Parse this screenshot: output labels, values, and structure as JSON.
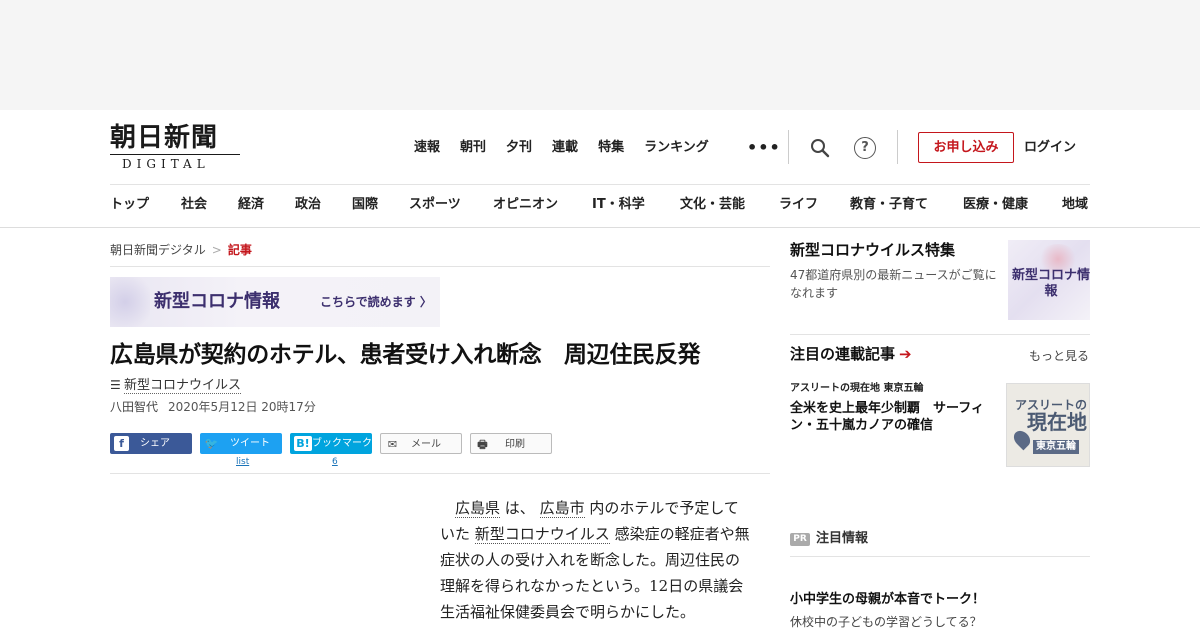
{
  "header": {
    "logo_main": "朝日新聞",
    "logo_sub": "DIGITAL",
    "topnav": [
      "速報",
      "朝刊",
      "夕刊",
      "連載",
      "特集",
      "ランキング"
    ],
    "more_glyph": "•••",
    "help_glyph": "?",
    "apply_label": "お申し込み",
    "login_label": "ログイン",
    "categories": [
      "トップ",
      "社会",
      "経済",
      "政治",
      "国際",
      "スポーツ",
      "オピニオン",
      "IT・科学",
      "文化・芸能",
      "ライフ",
      "教育・子育て",
      "医療・健康",
      "地域"
    ]
  },
  "breadcrumb": {
    "home": "朝日新聞デジタル",
    "separator": ">",
    "current": "記事"
  },
  "banner": {
    "main": "新型コロナ情報",
    "sub": "こちらで読めます 〉"
  },
  "article": {
    "headline": "広島県が契約のホテル、患者受け入れ断念　周辺住民反発",
    "tag_icon": "☰",
    "tag": "新型コロナウイルス",
    "author": "八田智代",
    "date": "2020年5月12日 20時17分",
    "body": {
      "kw1": "広島県",
      "t1": " は、 ",
      "kw2": "広島市",
      "t2": " 内のホテルで予定していた ",
      "kw3": "新型コロナウイルス",
      "t3": " 感染症の軽症者や無症状の人の受け入れを断念した。周辺住民の理解を得られなかったという。12日の県議会生活福祉保健委員会で明らかにした。"
    }
  },
  "share": {
    "facebook": {
      "icon": "f",
      "label": "シェア"
    },
    "twitter": {
      "icon": "🐦",
      "label": "ツイート",
      "count": "list"
    },
    "hatena": {
      "icon": "B!",
      "label": "ブックマーク",
      "count": "6"
    },
    "mail": {
      "icon": "✉",
      "label": "メール"
    },
    "print": {
      "icon": "🖶",
      "label": "印刷"
    }
  },
  "sidebar": {
    "feature": {
      "title": "新型コロナウイルス特集",
      "desc": "47都道府県別の最新ニュースがご覧になれます",
      "thumb_text": "新型コロナ情報"
    },
    "series": {
      "title": "注目の連載記事",
      "arrow": "➔",
      "more": "もっと見る",
      "kicker": "アスリートの現在地 東京五輪",
      "item_title": "全米を史上最年少制覇　サーフィン・五十嵐カノアの確信",
      "thumb_line1": "アスリートの",
      "thumb_line2": "現在地",
      "thumb_line3": "東京五輪"
    },
    "pr": {
      "badge": "PR",
      "label": "注目情報",
      "item_title": "小中学生の母親が本音でトーク！",
      "item_sub": "休校中の子どもの学習どうしてる？"
    }
  },
  "colors": {
    "accent_red": "#c4161c",
    "facebook_blue": "#3b5998",
    "twitter_blue": "#1da1f2",
    "hatena_blue": "#00a4de",
    "banner_purple": "#3c2f6e"
  }
}
